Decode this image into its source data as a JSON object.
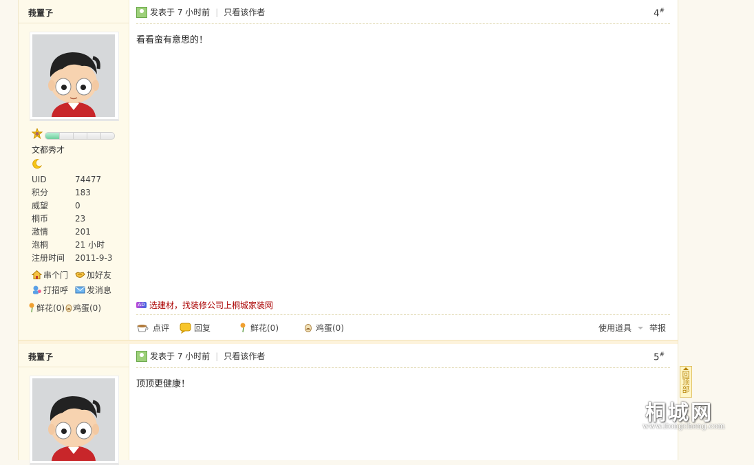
{
  "posts": [
    {
      "author": "莪罿孒",
      "posted": "发表于 7 小时前",
      "only_author": "只看该作者",
      "floor": "4",
      "floor_mark": "#",
      "message": "看看蛮有意思的！",
      "rank_title": "文都秀才",
      "level_progress": 0.2,
      "stats": [
        {
          "label": "UID",
          "value": "74477"
        },
        {
          "label": "积分",
          "value": "183"
        },
        {
          "label": "威望",
          "value": "0"
        },
        {
          "label": "桐币",
          "value": "23"
        },
        {
          "label": "激情",
          "value": "201"
        },
        {
          "label": "泡桐",
          "value": "21 小时"
        },
        {
          "label": "注册时间",
          "value": "2011-9-3"
        }
      ],
      "actions": {
        "visit": "串个门",
        "add_friend": "加好友",
        "greet": "打招呼",
        "message": "发消息"
      },
      "flower_label": "鲜花(0)",
      "egg_label": "鸡蛋(0)",
      "ad_text": "选建材，找装修公司上桐城家装网",
      "ad_badge": "AD",
      "footer": {
        "comment": "点评",
        "reply": "回复",
        "flower": "鲜花(0)",
        "egg": "鸡蛋(0)",
        "tools": "使用道具",
        "report": "举报"
      }
    },
    {
      "author": "莪罿孒",
      "posted": "发表于 7 小时前",
      "only_author": "只看该作者",
      "floor": "5",
      "floor_mark": "#",
      "message": "顶顶更健康！"
    }
  ],
  "back_to_top": "回顶部",
  "watermark": {
    "title": "桐城网",
    "url": "www.itongcheng.com"
  },
  "colors": {
    "ad_text": "#aa0000",
    "level_fill": "#6fcf9c",
    "sidebar_bg": "#fefaea"
  }
}
